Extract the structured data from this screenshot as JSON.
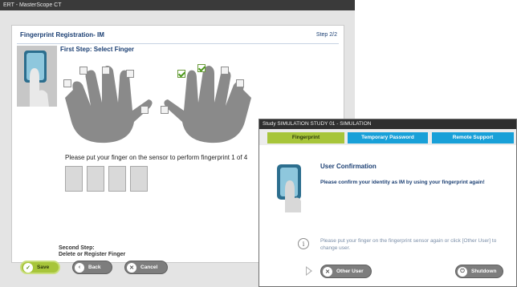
{
  "window": {
    "title": "ERT - MasterScope CT"
  },
  "registration": {
    "title": "Fingerprint Registration- IM",
    "step": "Step 2/2",
    "first_step": "First Step: Select Finger",
    "instruction": "Please put your finger on the sensor to perform fingerprint 1 of 4",
    "second_step_line1": "Second Step:",
    "second_step_line2": "Delete or Register Finger",
    "fingers": [
      {
        "hand": "left",
        "checked": false
      },
      {
        "hand": "left",
        "checked": false
      },
      {
        "hand": "left",
        "checked": false
      },
      {
        "hand": "left",
        "checked": false
      },
      {
        "hand": "left",
        "checked": false
      },
      {
        "hand": "right",
        "checked": false
      },
      {
        "hand": "right",
        "checked": true
      },
      {
        "hand": "right",
        "checked": true
      },
      {
        "hand": "right",
        "checked": false
      },
      {
        "hand": "right",
        "checked": false
      }
    ],
    "progress_boxes": 4
  },
  "footer": {
    "save_label": "Save",
    "back_label": "Back",
    "cancel_label": "Cancel"
  },
  "dialog": {
    "title": "Study SIMULATION STUDY 01 - SIMULATION",
    "tabs": [
      "Fingerprint",
      "Temporary Password",
      "Remote Support"
    ],
    "active_tab": "Fingerprint",
    "heading": "User Confirmation",
    "message": "Please confirm your identity as IM by using your fingerprint again!",
    "info": "Please put your finger on the fingerprint sensor again or click [Other User] to change user.",
    "other_user_label": "Other User",
    "shutdown_label": "Shutdown"
  },
  "colors": {
    "accent_green": "#a7c53a",
    "tab_blue": "#18a0d8",
    "title_blue": "#1b3f73"
  }
}
